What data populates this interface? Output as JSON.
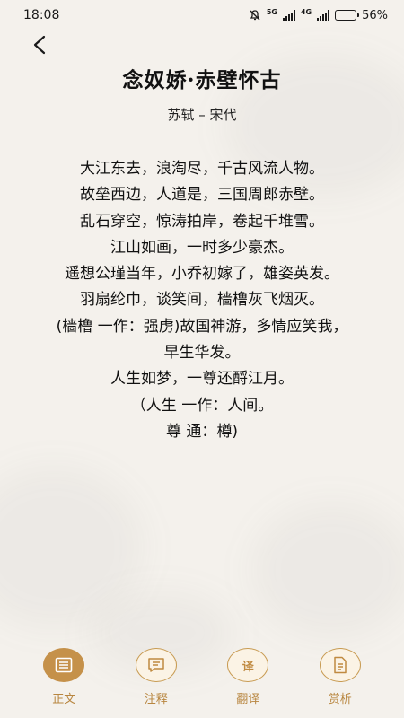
{
  "status_bar": {
    "time": "18:08",
    "network_5g": "5G",
    "network_4g": "4G",
    "battery_text": "56%",
    "battery_level": 0.56
  },
  "poem": {
    "title": "念奴娇·赤壁怀古",
    "author": "苏轼 – 宋代",
    "lines": [
      "大江东去，浪淘尽，千古风流人物。",
      "故垒西边，人道是，三国周郎赤壁。",
      "乱石穿空，惊涛拍岸，卷起千堆雪。",
      "江山如画，一时多少豪杰。",
      "遥想公瑾当年，小乔初嫁了，雄姿英发。",
      "羽扇纶巾，谈笑间，樯橹灰飞烟灭。",
      "(樯橹 一作：强虏)故国神游，多情应笑我，",
      "早生华发。",
      "人生如梦，一尊还酹江月。",
      "（人生 一作：人间。",
      "尊 通：樽)"
    ]
  },
  "nav": {
    "items": [
      {
        "label": "正文",
        "icon": "document-lines-icon",
        "active": true
      },
      {
        "label": "注释",
        "icon": "comment-icon",
        "active": false
      },
      {
        "label": "翻译",
        "icon": "translate-icon",
        "glyph": "译",
        "active": false
      },
      {
        "label": "赏析",
        "icon": "analysis-doc-icon",
        "active": false
      }
    ]
  },
  "colors": {
    "accent": "#c5914a",
    "background": "#f4f1ec",
    "text": "#111111"
  }
}
